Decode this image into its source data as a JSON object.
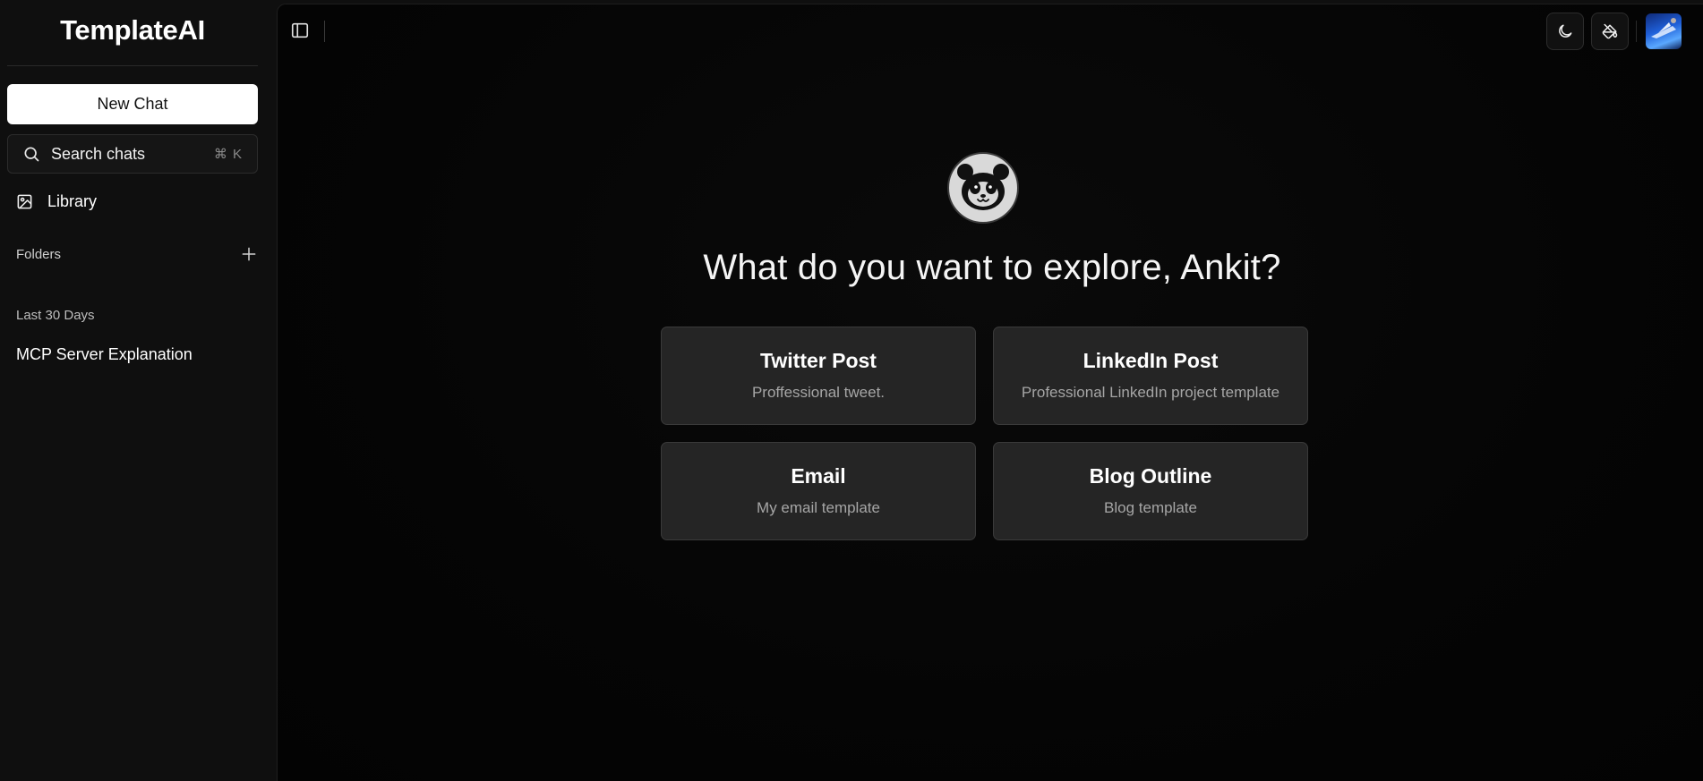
{
  "sidebar": {
    "brand": "TemplateAI",
    "new_chat_label": "New Chat",
    "search": {
      "label": "Search chats",
      "shortcut": "⌘ K",
      "icon": "search-icon"
    },
    "library": {
      "label": "Library",
      "icon": "image-icon"
    },
    "folders": {
      "label": "Folders",
      "add_icon": "plus-icon"
    },
    "recent": {
      "title": "Last 30 Days",
      "items": [
        {
          "label": "MCP Server Explanation"
        }
      ]
    }
  },
  "topbar": {
    "toggle_icon": "sidebar-toggle-icon",
    "theme_icon": "moon-icon",
    "paint_icon": "paint-bucket-icon",
    "avatar_icon": "user-avatar"
  },
  "main": {
    "logo_icon": "panda-icon",
    "headline": "What do you want to explore, Ankit?",
    "templates": [
      {
        "title": "Twitter Post",
        "description": "Proffessional tweet."
      },
      {
        "title": "LinkedIn Post",
        "description": "Professional LinkedIn project template"
      },
      {
        "title": "Email",
        "description": "My email template"
      },
      {
        "title": "Blog Outline",
        "description": "Blog template"
      }
    ]
  },
  "colors": {
    "background": "#0f0f0f",
    "main_background": "#050505",
    "card_background": "#252525",
    "card_border": "#3a3a3a",
    "muted_text": "#a6a6a6",
    "primary_button": "#ffffff"
  }
}
